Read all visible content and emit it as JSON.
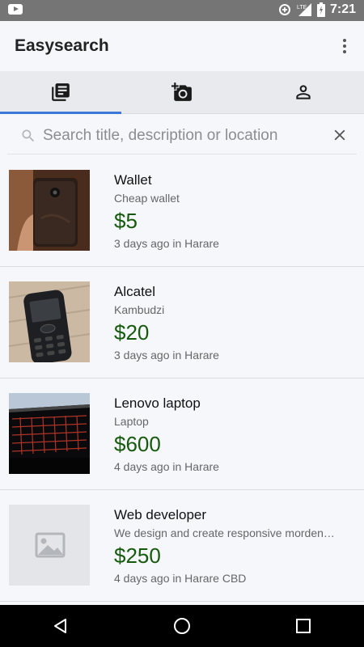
{
  "status_bar": {
    "time": "7:21",
    "network": "LTE",
    "icons": [
      "youtube-icon",
      "data-saver-icon",
      "lte-signal-icon",
      "battery-charging-icon"
    ]
  },
  "app_bar": {
    "title": "Easysearch",
    "menu_icon": "more-vert-icon"
  },
  "tabs": [
    {
      "icon": "library-books-icon",
      "active": true
    },
    {
      "icon": "add-a-photo-icon",
      "active": false
    },
    {
      "icon": "person-icon",
      "active": false
    }
  ],
  "search": {
    "placeholder": "Search title, description or location",
    "value": ""
  },
  "listings": [
    {
      "title": "Wallet",
      "description": "Cheap wallet",
      "price": "$5",
      "meta": "3 days ago in Harare",
      "image": "wallet-photo"
    },
    {
      "title": "Alcatel",
      "description": "Kambudzi",
      "price": "$20",
      "meta": "3 days ago in Harare",
      "image": "phone-photo"
    },
    {
      "title": "Lenovo laptop",
      "description": "Laptop",
      "price": "$600",
      "meta": "4 days ago in Harare",
      "image": "laptop-photo"
    },
    {
      "title": "Web developer",
      "description": "We design and create responsive morden…",
      "price": "$250",
      "meta": "4 days ago in Harare CBD",
      "image": "placeholder-image-icon"
    }
  ],
  "colors": {
    "accent": "#3b78d8",
    "price": "#175a0e",
    "status_bar": "#757575"
  }
}
